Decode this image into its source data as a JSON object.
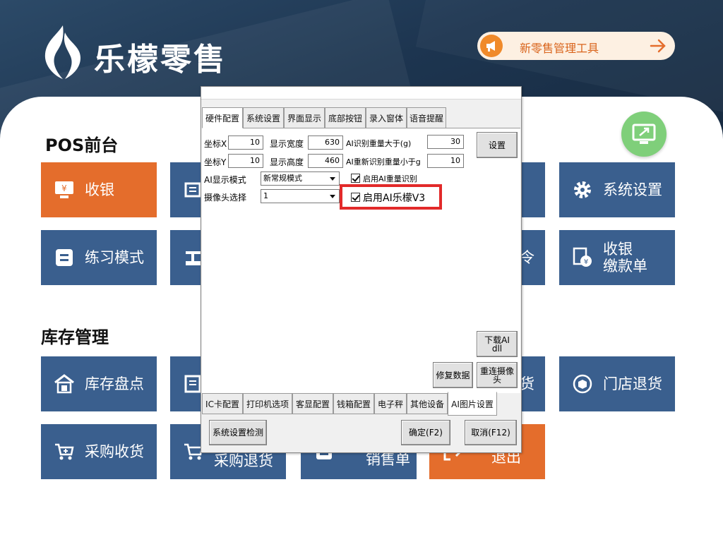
{
  "app": {
    "brand_name": "乐檬零售",
    "promo_text": "新零售管理工具"
  },
  "sections": {
    "pos": "POS前台",
    "stock": "库存管理"
  },
  "tiles": {
    "cashier": "收银",
    "system_settings": "系统设置",
    "practice_mode": "练习模式",
    "partial_ling": "令",
    "payment_slip_line1": "收银",
    "payment_slip_line2": "缴款单",
    "inventory_count": "库存盘点",
    "partial_huo": "货",
    "store_return": "门店退货",
    "purchase_receive": "采购收货",
    "purchase_return": "采购退货",
    "sales_order": "销售单",
    "exit": "退出"
  },
  "dialog": {
    "tabs_top": [
      "硬件配置",
      "系统设置",
      "界面显示",
      "底部按钮",
      "录入窗体",
      "语音提醒"
    ],
    "active_top_tab": "硬件配置",
    "coord_x_label": "坐标X",
    "coord_x_value": "10",
    "coord_y_label": "坐标Y",
    "coord_y_value": "10",
    "display_width_label": "显示宽度",
    "display_width_value": "630",
    "display_height_label": "显示高度",
    "display_height_value": "460",
    "ai_weight_gt_label": "AI识别重量大于(g)",
    "ai_weight_gt_value": "30",
    "ai_reweight_lt_label": "AI重新识别重量小于g",
    "ai_reweight_lt_value": "10",
    "settings_button": "设置",
    "ai_display_mode_label": "AI显示模式",
    "ai_display_mode_value": "新常规模式",
    "camera_select_label": "摄像头选择",
    "camera_select_value": "1",
    "enable_ai_weight_label": "启用AI重量识别",
    "enable_ai_weight_checked": true,
    "enable_ai_lemeng_label": "启用AI乐檬V3",
    "enable_ai_lemeng_checked": true,
    "download_ai_dll_line1": "下载AI",
    "download_ai_dll_line2": "dll",
    "repair_data_button": "修复数据",
    "reconnect_camera_line1": "重连摄像",
    "reconnect_camera_line2": "头",
    "tabs_bottom": [
      "IC卡配置",
      "打印机选项",
      "客显配置",
      "钱箱配置",
      "电子秤",
      "其他设备",
      "AI图片设置"
    ],
    "active_bottom_tab": "AI图片设置",
    "system_check_button": "系统设置检测",
    "ok_button": "确定(F2)",
    "cancel_button": "取消(F12)"
  },
  "colors": {
    "tile_blue": "#3a5f8e",
    "tile_orange": "#e46d2c",
    "highlight_red": "#e22a2a",
    "header_dark": "#1d3550"
  }
}
